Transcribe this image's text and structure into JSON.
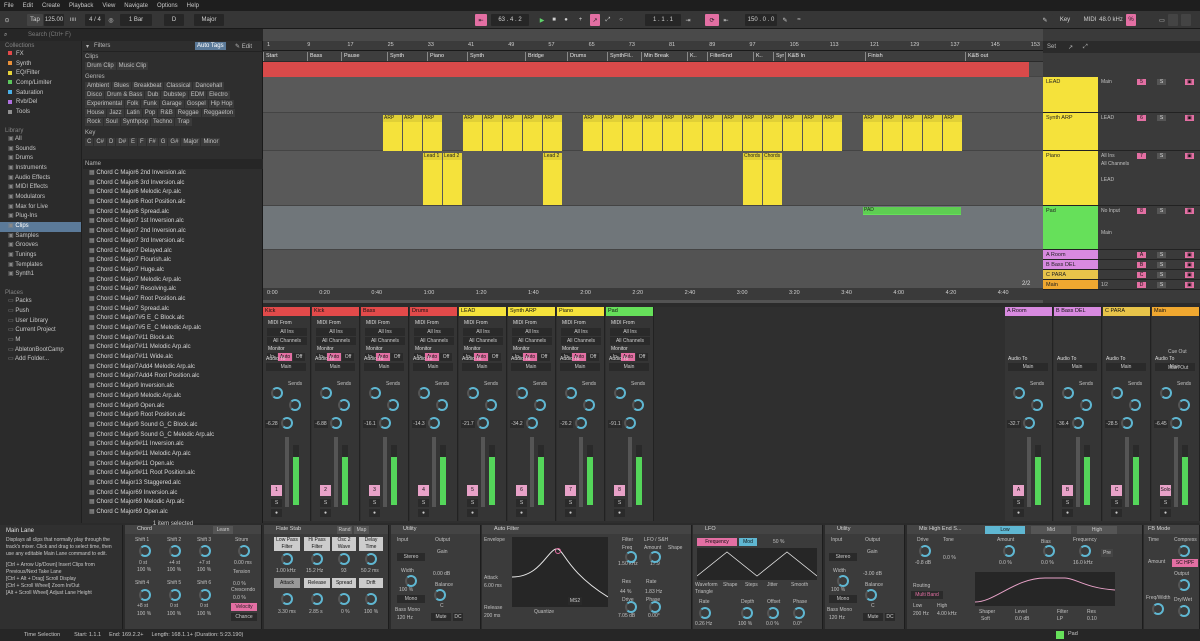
{
  "menu": [
    "File",
    "Edit",
    "Create",
    "Playback",
    "View",
    "Navigate",
    "Options",
    "Help"
  ],
  "transport": {
    "tap": "Tap",
    "bpm": "125.00",
    "sig": "4 / 4",
    "quant": "1 Bar",
    "key": "D",
    "scale": "Major",
    "pos": "63 . 4 . 2",
    "loop_start": "1 . 1 . 1",
    "loop_len": "150 . 0 . 0",
    "keylbl": "Key",
    "midi": "MIDI",
    "rate": "48.0 kHz",
    "cpu": "%"
  },
  "browser": {
    "search": "Search (Ctrl+ F)",
    "collections_head": "Collections",
    "collections": [
      {
        "n": "FX",
        "c": "#e24a4a"
      },
      {
        "n": "Synth",
        "c": "#e8903a"
      },
      {
        "n": "EQ/Filter",
        "c": "#e6d23a"
      },
      {
        "n": "Comp/Limiter",
        "c": "#5cc85c"
      },
      {
        "n": "Saturation",
        "c": "#4ab0e6"
      },
      {
        "n": "Rvb/Del",
        "c": "#b070e0"
      },
      {
        "n": "Tools",
        "c": "#909090"
      }
    ],
    "library_head": "Library",
    "library": [
      "All",
      "Sounds",
      "Drums",
      "Instruments",
      "Audio Effects",
      "MIDI Effects",
      "Modulators",
      "Max for Live",
      "Plug-Ins",
      "Clips",
      "Samples",
      "Grooves",
      "Tunings",
      "Templates",
      "Synth1"
    ],
    "places_head": "Places",
    "places": [
      "Packs",
      "Push",
      "User Library",
      "Current Project",
      "M",
      "AbletonBootCamp",
      "Add Folder..."
    ],
    "filters": "Filters",
    "autotags": "Auto Tags",
    "edit": "Edit",
    "clips_lbl": "Clips",
    "drumclip": "Drum Clip",
    "musicclip": "Music Clip",
    "genres_lbl": "Genres",
    "genres": [
      "Ambient",
      "Blues",
      "Breakbeat",
      "Classical",
      "Dancehall",
      "Disco",
      "Drum & Bass",
      "Dub",
      "Dubstep",
      "EDM",
      "Electro",
      "Experimental",
      "Folk",
      "Funk",
      "Garage",
      "Gospel",
      "Hip Hop",
      "House",
      "Jazz",
      "Latin",
      "Pop",
      "R&B",
      "Reggae",
      "Reggaeton",
      "Rock",
      "Soul",
      "Synthpop",
      "Techno",
      "Trap"
    ],
    "key_lbl": "Key",
    "keys": [
      "C",
      "C#",
      "D",
      "D#",
      "E",
      "F",
      "F#",
      "G",
      "G#",
      "Major",
      "Minor"
    ],
    "name_lbl": "Name",
    "files": [
      "Chord C Major6 2nd Inversion.alc",
      "Chord C Major6 3rd Inversion.alc",
      "Chord C Major6 Melodic Arp.alc",
      "Chord C Major6 Root Position.alc",
      "Chord C Major6 Spread.alc",
      "Chord C Major7 1st Inversion.alc",
      "Chord C Major7 2nd Inversion.alc",
      "Chord C Major7 3rd Inversion.alc",
      "Chord C Major7 Delayed.alc",
      "Chord C Major7 Flourish.alc",
      "Chord C Major7 Huge.alc",
      "Chord C Major7 Melodic Arp.alc",
      "Chord C Major7 Resolving.alc",
      "Chord C Major7 Root Position.alc",
      "Chord C Major7 Spread.alc",
      "Chord C Major7#5 E_C Block.alc",
      "Chord C Major7#5 E_C Melodic Arp.alc",
      "Chord C Major7#11 Block.alc",
      "Chord C Major7#11 Melodic Arp.alc",
      "Chord C Major7#11 Wide.alc",
      "Chord C Major7Add4 Melodic Arp.alc",
      "Chord C Major7Add4 Root Position.alc",
      "Chord C Major9 Inversion.alc",
      "Chord C Major9 Melodic Arp.alc",
      "Chord C Major9 Open.alc",
      "Chord C Major9 Root Position.alc",
      "Chord C Major9 Sound G_C Block.alc",
      "Chord C Major9 Sound G_C Melodic Arp.alc",
      "Chord C Major9#11 Inversion.alc",
      "Chord C Major9#11 Melodic Arp.alc",
      "Chord C Major9#11 Open.alc",
      "Chord C Major9#11 Root Position.alc",
      "Chord C Major13 Staggered.alc",
      "Chord C Major69 Inversion.alc",
      "Chord C Major69 Melodic Arp.alc",
      "Chord C Major69 Open.alc"
    ],
    "selected": "1 item selected"
  },
  "arrangement": {
    "ruler": [
      "1",
      "9",
      "17",
      "25",
      "33",
      "41",
      "49",
      "57",
      "65",
      "73",
      "81",
      "89",
      "97",
      "105",
      "113",
      "121",
      "129",
      "137",
      "145",
      "153"
    ],
    "locators": [
      "Start",
      "Bass",
      "Pause",
      "Synth",
      "Piano",
      "Synth",
      "Bridge",
      "Drums",
      "SynthFil..",
      "Min Break",
      "K..",
      "FilterEnd",
      "K..",
      "Synth",
      "K&B In",
      "Finish",
      "K&B out"
    ],
    "times": [
      "0:00",
      "0:20",
      "0:40",
      "1:00",
      "1:20",
      "1:40",
      "2:00",
      "2:20",
      "2:40",
      "3:00",
      "3:20",
      "3:40",
      "4:00",
      "4:20",
      "4:40"
    ],
    "arp_label": "ARP",
    "lead1": "Lead 1",
    "lead2": "Lead 2",
    "chords": "Chords",
    "pad": "PAD",
    "zoom": "2/2"
  },
  "tracks": [
    {
      "name": "LEAD",
      "color": "#f5e23b",
      "io": "Main"
    },
    {
      "name": "Synth ARP",
      "color": "#f5e23b",
      "io": "LEAD"
    },
    {
      "name": "Piano",
      "color": "#f5e23b",
      "io": "All Ins",
      "io2": "All Channels",
      "io3": "LEAD"
    },
    {
      "name": "Pad",
      "color": "#66e05a",
      "io": "No Input",
      "io2": "Main"
    },
    {
      "name": "A Room",
      "color": "#d88ae0"
    },
    {
      "name": "B Bass DEL",
      "color": "#d88ae0"
    },
    {
      "name": "C PARA",
      "color": "#e8c44a"
    },
    {
      "name": "Main",
      "color": "#f0a830",
      "io": "1/2"
    }
  ],
  "mixer": {
    "strips": [
      {
        "name": "Kick",
        "color": "#e24a4a",
        "vol": "-6.28",
        "num": "1"
      },
      {
        "name": "Kick",
        "color": "#e24a4a",
        "vol": "-6.88",
        "num": "2"
      },
      {
        "name": "Bass",
        "color": "#e24a4a",
        "vol": "-16.1",
        "num": "3"
      },
      {
        "name": "Drums",
        "color": "#e24a4a",
        "vol": "-14.3",
        "num": "4"
      },
      {
        "name": "LEAD",
        "color": "#f5e23b",
        "vol": "-21.7",
        "num": "5"
      },
      {
        "name": "Synth ARP",
        "color": "#f5e23b",
        "vol": "-34.2",
        "num": "6"
      },
      {
        "name": "Piano",
        "color": "#f5e23b",
        "vol": "-26.2",
        "num": "7"
      },
      {
        "name": "Pad",
        "color": "#66e05a",
        "vol": "-91.1",
        "num": "8"
      }
    ],
    "returns": [
      {
        "name": "A Room",
        "color": "#d88ae0",
        "vol": "-32.7",
        "num": "A"
      },
      {
        "name": "B Bass DEL",
        "color": "#d88ae0",
        "vol": "-36.4",
        "num": "B"
      },
      {
        "name": "C PARA",
        "color": "#e8c44a",
        "vol": "-28.5",
        "num": "C"
      },
      {
        "name": "Main",
        "color": "#f0a830",
        "vol": "-6.45",
        "num": "Solo"
      }
    ],
    "midifrom": "MIDI From",
    "allins": "All Ins",
    "allch": "All Channels",
    "monitor": "Monitor",
    "in": "In",
    "auto": "Auto",
    "off": "Off",
    "audioto": "Audio To",
    "main": "Main",
    "sends": "Sends",
    "noinput": "No Input",
    "cueout": "Cue Out",
    "mainout": "Main Out",
    "half": "1/2"
  },
  "devices": {
    "info_title": "Main Lane",
    "info_text": "Displays all clips that normally play through the track's mixer. Click and drag to select time, then use any editable Main Lane command to edit.",
    "info_keys": "[Ctrl + Arrow Up/Down] Insert Clips from Previous/Next Take Lane\n[Ctrl + Alt + Drag] Scroll Display\n[Ctrl + Scroll Wheel] Zoom In/Out\n[Alt + Scroll Wheel] Adjust Lane Height",
    "chord": {
      "title": "Chord",
      "learn": "Learn",
      "shift1": "Shift 1",
      "shift2": "Shift 2",
      "shift3": "Shift 3",
      "shift4": "Shift 4",
      "shift5": "Shift 5",
      "shift6": "Shift 6",
      "strum": "Strum",
      "tension": "Tension",
      "crescendo": "Crescendo",
      "v1": "0 st",
      "v2": "+4 st",
      "v3": "+7 st",
      "p1": "100 %",
      "sv4": "+8 st",
      "v0ms": "0.00 ms",
      "pct0": "0.0 %",
      "velocity": "Velocity",
      "chance": "Chance"
    },
    "flatestab": {
      "title": "Flate Stab",
      "rand": "Rand",
      "map": "Map",
      "lp": "Low Pass Filter",
      "hp": "Hi Pass Filter",
      "osc2": "Osc 2 Wave",
      "delay": "Delay Time",
      "v1": "1.00 kHz",
      "v2": "15.2 Hz",
      "v3": "93",
      "v4": "50.2 ms",
      "attack": "Attack",
      "release": "Release",
      "spread": "Spread",
      "drift": "Drift",
      "a": "3.30 ms",
      "r": "2.85 s",
      "s": "0 %",
      "d": "100 %"
    },
    "utility": {
      "title": "Utility",
      "input": "Input",
      "output": "Output",
      "gain": "Gain",
      "width": "Width",
      "balance": "Balance",
      "bassmono": "Bass Mono",
      "mono": "Mono",
      "hz": "120 Hz",
      "db": "0.00 dB",
      "pct": "100 %",
      "c": "C",
      "stereo": "Stereo"
    },
    "autofilter": {
      "title": "Auto Filter",
      "envelope": "Envelope",
      "filter": "Filter",
      "freq": "Freq",
      "res": "Res",
      "drive": "Drive",
      "lfo": "LFO / S&H",
      "amount": "Amount",
      "shape": "Shape",
      "rate": "Rate",
      "phase": "Phase",
      "quantize": "Quantize",
      "attack": "Attack",
      "release": "Release",
      "ms2": "MS2",
      "v1": "1.50 kHz",
      "v2": "17.9",
      "v3": "44 %",
      "v4": "1.83 Hz",
      "v5": "7.05 dB",
      "v6": "0.00°",
      "a": "6.00 ms",
      "r": "200 ms",
      "x100": "100",
      "x1k": "1k",
      "x10k": "10k"
    },
    "lfo": {
      "title": "LFO",
      "frequency": "Frequency",
      "mod": "Mod",
      "pct": "50 %",
      "waveform": "Waveform",
      "shape": "Shape",
      "steps": "Steps",
      "jitter": "Jitter",
      "smooth": "Smooth",
      "triangle": "Triangle",
      "rate": "Rate",
      "depth": "Depth",
      "offset": "Offset",
      "phase": "Phase",
      "v1": "0.26 Hz",
      "v2": "100 %",
      "v3": "0.0 %",
      "v4": "0.0°"
    },
    "utility2": {
      "title": "Utility",
      "input": "Input",
      "output": "Output",
      "gain": "Gain",
      "width": "Width",
      "balance": "Balance",
      "bassmono": "Bass Mono",
      "mono": "Mono",
      "hz": "120 Hz",
      "db": "-3.00 dB",
      "pct": "100 %",
      "c": "C",
      "stereo": "Stereo"
    },
    "mixhigh": {
      "title": "Mix High End S...",
      "drive": "Drive",
      "tone": "Tone",
      "low": "Low",
      "mid": "Mid",
      "high": "High",
      "amount": "Amount",
      "bias": "Bias",
      "frequency": "Frequency",
      "routing": "Routing",
      "multiband": "Multi Band",
      "lowf": "200 Hz",
      "highf": "4.00 kHz",
      "shaper": "Shaper",
      "level": "Level",
      "filter": "Filter",
      "res": "Res",
      "soft": "Soft",
      "lp": "LP",
      "dB": "-0.8 dB",
      "pct": "0.0 %",
      "freqv": "16.0 kHz",
      "pre": "Pre",
      "v0": "0.0 dB",
      "resv": "0.10"
    },
    "fbmode": {
      "title": "FB Mode",
      "time": "Time",
      "amount": "Amount",
      "compress": "Compress",
      "output": "Output",
      "drywet": "Dry/Wet",
      "freqwidth": "Freq/Width",
      "schpf": "SC HPF"
    }
  },
  "status": {
    "sel": "Time Selection",
    "start": "Start: 1.1.1",
    "end": "End: 169.2.2+",
    "len": "Length: 168.1.1+ (Duration: 5:23.190)",
    "track": "Pad"
  }
}
